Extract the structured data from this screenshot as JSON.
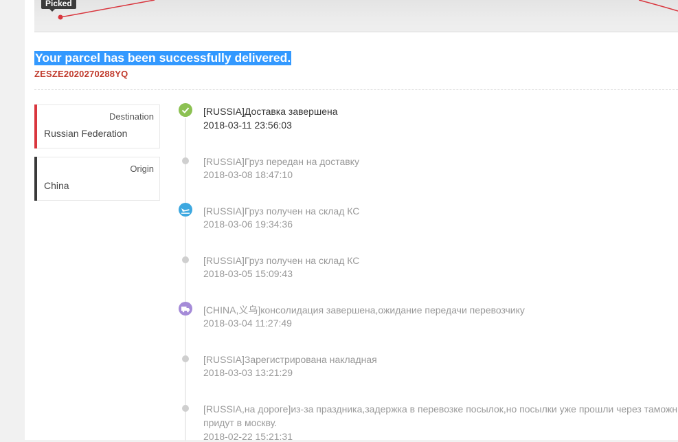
{
  "map": {
    "picked_label": "Picked"
  },
  "status_title": "Your parcel has been successfully delivered.",
  "tracking_number": "ZESZE2020270288YQ",
  "destination": {
    "label": "Destination",
    "value": "Russian Federation",
    "accent": "#d9363e"
  },
  "origin": {
    "label": "Origin",
    "value": "China",
    "accent": "#3a3a3a"
  },
  "events": [
    {
      "icon": "check-icon",
      "text": "[RUSSIA]Доставка завершена",
      "time": "2018-03-11 23:56:03"
    },
    {
      "icon": "dot",
      "text": "[RUSSIA]Груз передан на доставку",
      "time": "2018-03-08 18:47:10"
    },
    {
      "icon": "plane-landing-icon",
      "text": "[RUSSIA]Груз получен на склад КС",
      "time": "2018-03-06 19:34:36"
    },
    {
      "icon": "dot",
      "text": "[RUSSIA]Груз получен на склад КС",
      "time": "2018-03-05 15:09:43"
    },
    {
      "icon": "truck-icon",
      "text": "[CHINA,义乌]консолидация завершена,ожидание передачи перевозчику",
      "time": "2018-03-04 11:27:49"
    },
    {
      "icon": "dot",
      "text": "[RUSSIA]Зарегистрирована накладная",
      "time": "2018-03-03 13:21:29"
    },
    {
      "icon": "dot",
      "text": "[RUSSIA,на дороге]из-за праздника,задержка в перевозке посылок,но посылки уже прошли через таможн",
      "text2": "придут в москву.",
      "time": "2018-02-22 15:21:31"
    }
  ],
  "colors": {
    "delivered_green": "#8cc152",
    "plane_blue": "#3da8e0",
    "truck_purple": "#a58bd8",
    "route_red": "#d9363e"
  }
}
